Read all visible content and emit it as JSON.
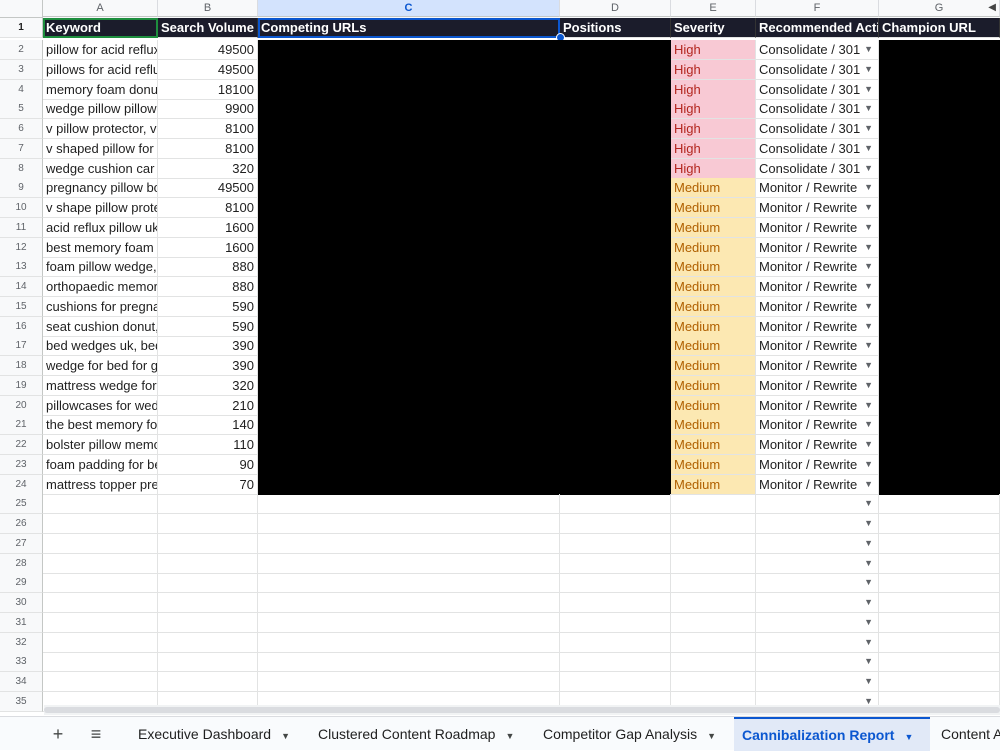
{
  "columns": [
    {
      "letter": "A",
      "left": 0
    },
    {
      "letter": "B"
    },
    {
      "letter": "C"
    },
    {
      "letter": "D"
    },
    {
      "letter": "E"
    },
    {
      "letter": "F"
    },
    {
      "letter": "G"
    }
  ],
  "headers": {
    "keyword": "Keyword",
    "volume": "Search Volume",
    "competing": "Competing URLs",
    "positions": "Positions",
    "severity": "Severity",
    "action": "Recommended Action",
    "champion": "Champion URL"
  },
  "rows": [
    {
      "n": "2",
      "keyword": "pillow for acid reflux",
      "volume": "49500",
      "severity": "High",
      "action": "Consolidate / 301"
    },
    {
      "n": "3",
      "keyword": "pillows for acid reflux",
      "volume": "49500",
      "severity": "High",
      "action": "Consolidate / 301"
    },
    {
      "n": "4",
      "keyword": "memory foam donut",
      "volume": "18100",
      "severity": "High",
      "action": "Consolidate / 301"
    },
    {
      "n": "5",
      "keyword": "wedge pillow pillowcase",
      "volume": "9900",
      "severity": "High",
      "action": "Consolidate / 301"
    },
    {
      "n": "6",
      "keyword": "v pillow protector, v",
      "volume": "8100",
      "severity": "High",
      "action": "Consolidate / 301"
    },
    {
      "n": "7",
      "keyword": "v shaped pillow for p",
      "volume": "8100",
      "severity": "High",
      "action": "Consolidate / 301"
    },
    {
      "n": "8",
      "keyword": "wedge cushion car s",
      "volume": "320",
      "severity": "High",
      "action": "Consolidate / 301"
    },
    {
      "n": "9",
      "keyword": "pregnancy pillow bo",
      "volume": "49500",
      "severity": "Medium",
      "action": "Monitor / Rewrite"
    },
    {
      "n": "10",
      "keyword": "v shape pillow prote",
      "volume": "8100",
      "severity": "Medium",
      "action": "Monitor / Rewrite"
    },
    {
      "n": "11",
      "keyword": "acid reflux pillow uk,",
      "volume": "1600",
      "severity": "Medium",
      "action": "Monitor / Rewrite"
    },
    {
      "n": "12",
      "keyword": "best memory foam p",
      "volume": "1600",
      "severity": "Medium",
      "action": "Monitor / Rewrite"
    },
    {
      "n": "13",
      "keyword": "foam pillow wedge, ",
      "volume": "880",
      "severity": "Medium",
      "action": "Monitor / Rewrite"
    },
    {
      "n": "14",
      "keyword": "orthopaedic memory",
      "volume": "880",
      "severity": "Medium",
      "action": "Monitor / Rewrite"
    },
    {
      "n": "15",
      "keyword": "cushions for pregna",
      "volume": "590",
      "severity": "Medium",
      "action": "Monitor / Rewrite"
    },
    {
      "n": "16",
      "keyword": "seat cushion donut, ",
      "volume": "590",
      "severity": "Medium",
      "action": "Monitor / Rewrite"
    },
    {
      "n": "17",
      "keyword": "bed wedges uk, bed",
      "volume": "390",
      "severity": "Medium",
      "action": "Monitor / Rewrite"
    },
    {
      "n": "18",
      "keyword": "wedge for bed for ge",
      "volume": "390",
      "severity": "Medium",
      "action": "Monitor / Rewrite"
    },
    {
      "n": "19",
      "keyword": "mattress wedge for a",
      "volume": "320",
      "severity": "Medium",
      "action": "Monitor / Rewrite"
    },
    {
      "n": "20",
      "keyword": "pillowcases for wedg",
      "volume": "210",
      "severity": "Medium",
      "action": "Monitor / Rewrite"
    },
    {
      "n": "21",
      "keyword": "the best memory foa",
      "volume": "140",
      "severity": "Medium",
      "action": "Monitor / Rewrite"
    },
    {
      "n": "22",
      "keyword": "bolster pillow memo",
      "volume": "110",
      "severity": "Medium",
      "action": "Monitor / Rewrite"
    },
    {
      "n": "23",
      "keyword": "foam padding for be",
      "volume": "90",
      "severity": "Medium",
      "action": "Monitor / Rewrite"
    },
    {
      "n": "24",
      "keyword": "mattress topper preg",
      "volume": "70",
      "severity": "Medium",
      "action": "Monitor / Rewrite"
    }
  ],
  "empty_rows": [
    "25",
    "26",
    "27",
    "28",
    "29",
    "30",
    "31",
    "32",
    "33",
    "34",
    "35"
  ],
  "tabs": [
    {
      "label": "Executive Dashboard"
    },
    {
      "label": "Clustered Content Roadmap"
    },
    {
      "label": "Competitor Gap Analysis"
    },
    {
      "label": "Cannibalization Report",
      "active": true
    },
    {
      "label": "Content A"
    }
  ],
  "icons": {
    "add_sheet": "+",
    "all_sheets": "≡",
    "dropdown": "▼",
    "scroll_left": "◀"
  }
}
